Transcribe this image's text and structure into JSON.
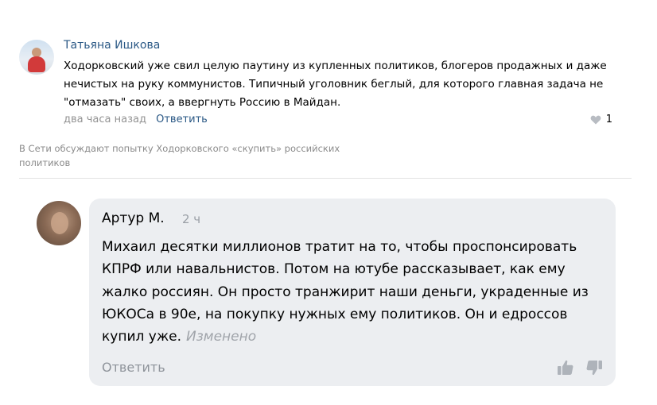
{
  "comment1": {
    "author": "Татьяна Ишкова",
    "text": "Ходорковский уже свил целую паутину из купленных политиков, блогеров продажных и даже нечистых на руку коммунистов. Типичный уголовник беглый, для которого главная задача не \"отмазать\" своих, а ввергнуть Россию в Майдан.",
    "time": "два часа назад",
    "reply_label": "Ответить",
    "like_count": "1",
    "like_icon": "heart-icon"
  },
  "caption": "В Сети обсуждают попытку Ходорковского «скупить» российских политиков",
  "comment2": {
    "author": "Артур М.",
    "time": "2 ч",
    "text": "Михаил десятки миллионов тратит на то, чтобы проспонсировать КПРФ или навальнистов. Потом на ютубе рассказывает, как ему жалко россиян. Он просто транжирит наши деньги, украденные из ЮКОСа в 90е, на покупку нужных ему политиков. Он и едроссов купил уже.",
    "edited_label": "Изменено",
    "reply_label": "Ответить",
    "like_icon": "thumbs-up-icon",
    "dislike_icon": "thumbs-down-icon"
  },
  "colors": {
    "link": "#2a5885",
    "muted": "#939393",
    "bubble_bg": "#eceef1"
  }
}
